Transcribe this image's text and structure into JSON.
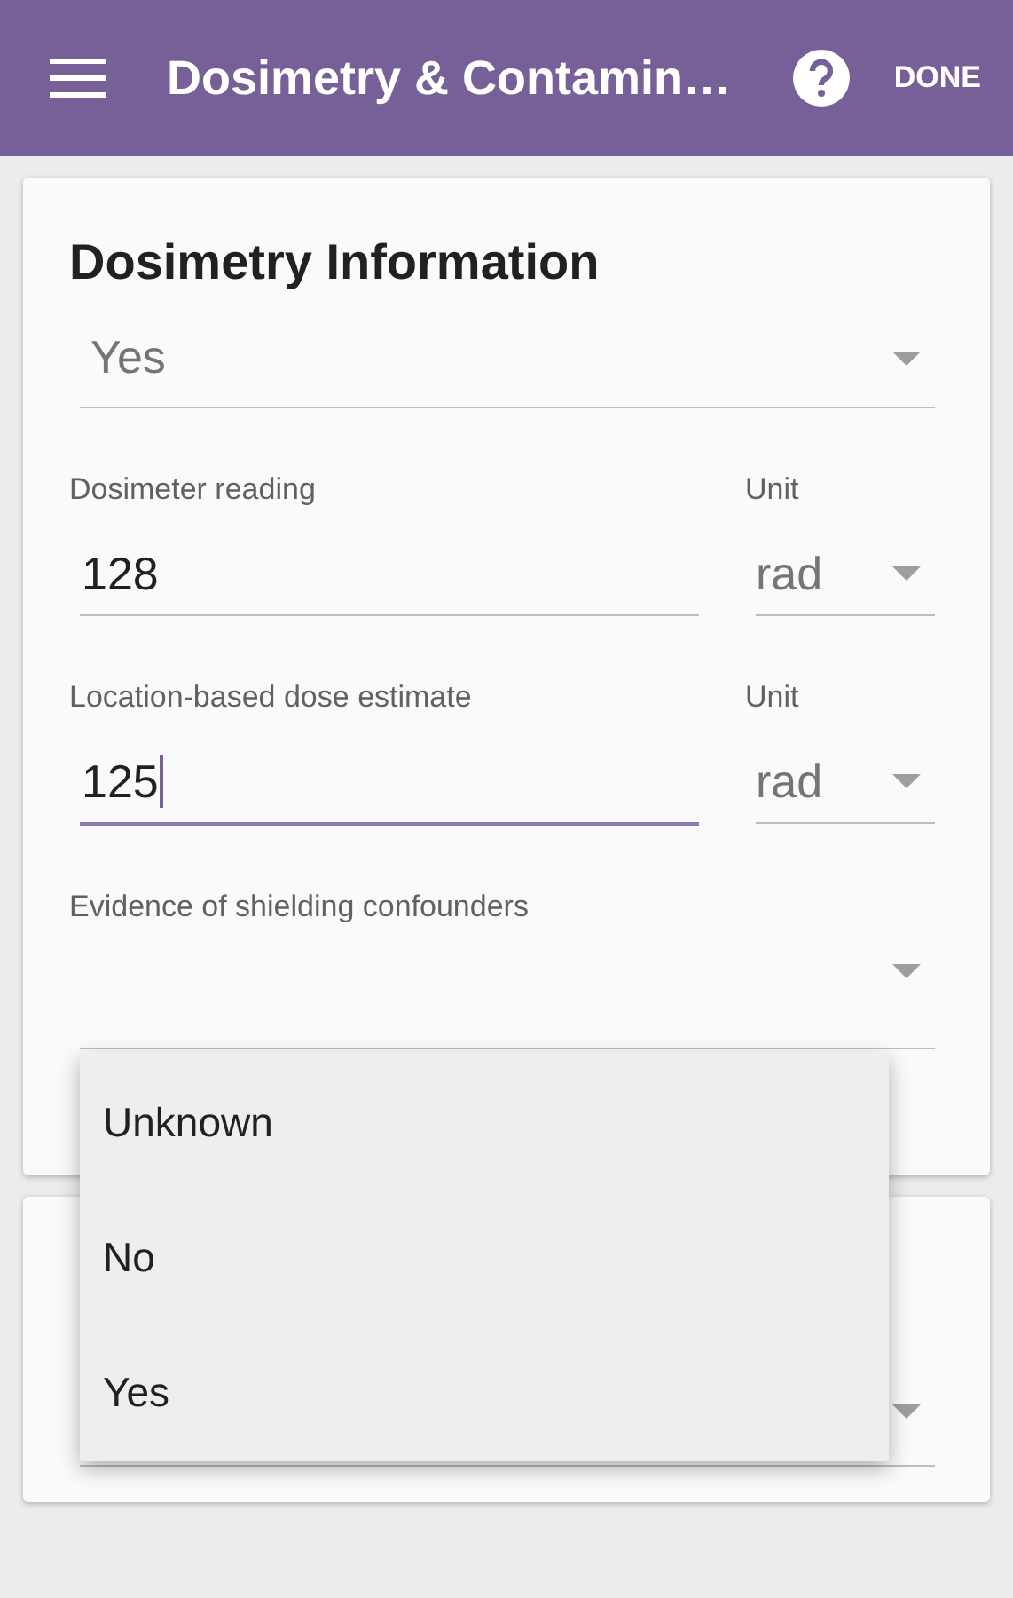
{
  "app_bar": {
    "title": "Dosimetry & Contamin…",
    "action": "DONE"
  },
  "card": {
    "title": "Dosimetry Information",
    "select_value": "Yes",
    "rows": [
      {
        "label": "Dosimeter reading",
        "value": "128",
        "focused": false,
        "unit_label": "Unit",
        "unit": "rad"
      },
      {
        "label": "Location-based dose estimate",
        "value": "125",
        "focused": true,
        "unit_label": "Unit",
        "unit": "rad"
      }
    ],
    "shielding_label": "Evidence of shielding confounders"
  },
  "menu": {
    "options": [
      "Unknown",
      "No",
      "Yes"
    ]
  }
}
